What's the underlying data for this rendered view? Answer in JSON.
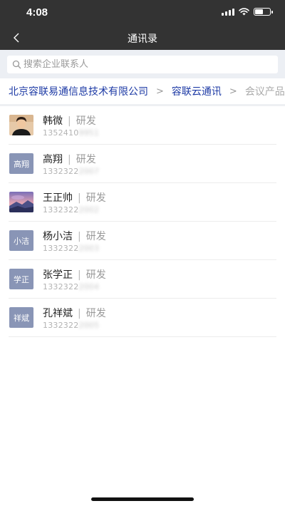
{
  "status_bar": {
    "time": "4:08"
  },
  "nav": {
    "title": "通讯录"
  },
  "search": {
    "placeholder": "搜索企业联系人"
  },
  "breadcrumb": {
    "items": [
      "北京容联易通信息技术有限公司",
      "容联云通讯",
      "会议产品"
    ],
    "separator": ">"
  },
  "contacts": [
    {
      "name": "韩微",
      "dept": "研发",
      "phone_visible": "1352410",
      "phone_hidden": "9951",
      "avatar": {
        "type": "photo",
        "icon": "person-photo"
      }
    },
    {
      "name": "高翔",
      "dept": "研发",
      "phone_visible": "1332322",
      "phone_hidden": "2007",
      "avatar": {
        "type": "text",
        "text": "高翔"
      }
    },
    {
      "name": "王正帅",
      "dept": "研发",
      "phone_visible": "1332322",
      "phone_hidden": "2002",
      "avatar": {
        "type": "photo",
        "icon": "landscape-photo"
      }
    },
    {
      "name": "杨小洁",
      "dept": "研发",
      "phone_visible": "1332322",
      "phone_hidden": "2003",
      "avatar": {
        "type": "text",
        "text": "小洁"
      }
    },
    {
      "name": "张学正",
      "dept": "研发",
      "phone_visible": "1332322",
      "phone_hidden": "2004",
      "avatar": {
        "type": "text",
        "text": "学正"
      }
    },
    {
      "name": "孔祥斌",
      "dept": "研发",
      "phone_visible": "1332322",
      "phone_hidden": "2005",
      "avatar": {
        "type": "text",
        "text": "祥斌"
      }
    }
  ],
  "colors": {
    "header_bg": "#333333",
    "search_bg": "#eceff4",
    "breadcrumb_link": "#1d3aa5",
    "avatar_bg": "#8995b6"
  }
}
